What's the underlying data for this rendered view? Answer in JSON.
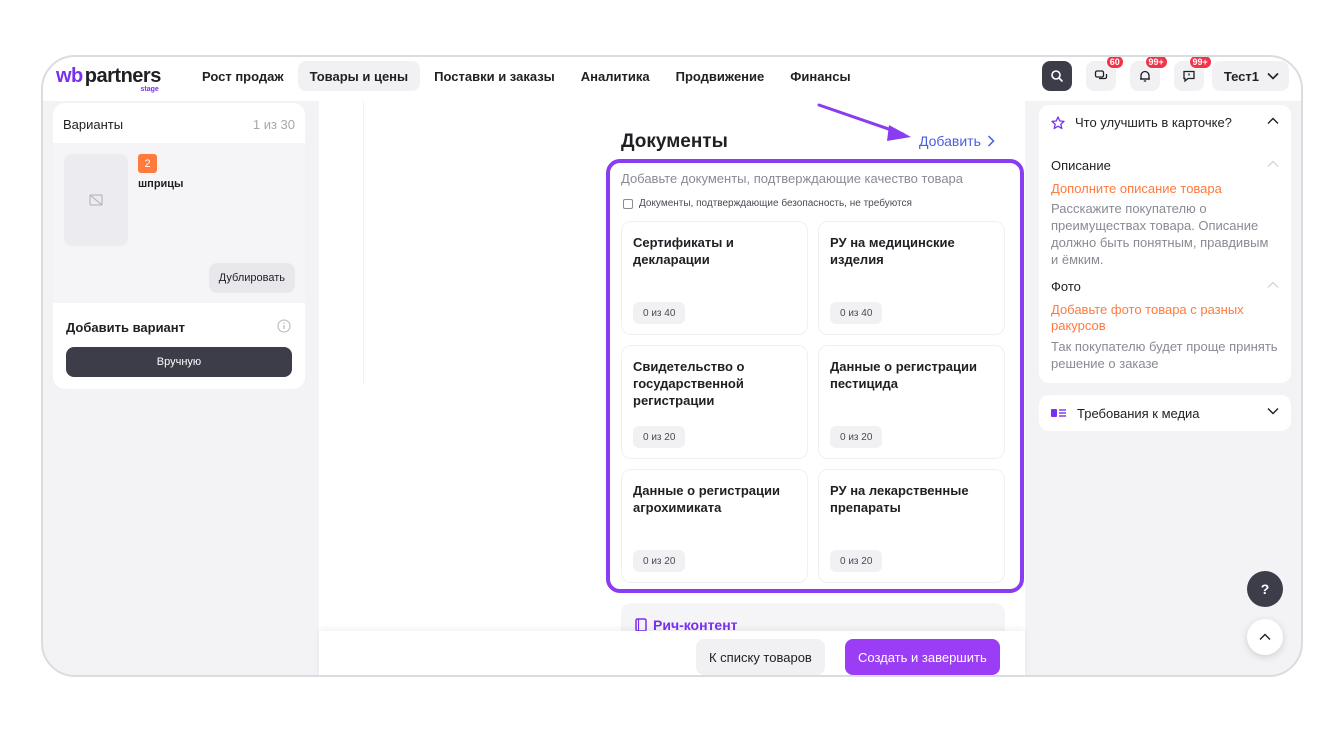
{
  "brand": {
    "wb": "wb",
    "partners": "partners",
    "env": "stage"
  },
  "nav": [
    "Рост продаж",
    "Товары и цены",
    "Поставки и заказы",
    "Аналитика",
    "Продвижение",
    "Финансы"
  ],
  "header": {
    "badges": {
      "chat": "60",
      "notifications": "99+",
      "support": "99+"
    },
    "user": "Тест1"
  },
  "variants": {
    "title": "Варианты",
    "count": "1 из 30",
    "item_number": "2",
    "item_name": "шприцы",
    "duplicate_label": "Дублировать",
    "add_variant_label": "Добавить вариант",
    "manual_label": "Вручную"
  },
  "documents": {
    "title": "Документы",
    "add_label": "Добавить",
    "subtitle": "Добавьте документы, подтверждающие качество товара",
    "checkbox_label": "Документы, подтверждающие безопасность, не требуются",
    "cards": [
      {
        "title": "Сертификаты и декларации",
        "count": "0 из 40"
      },
      {
        "title": "РУ на медицинские изделия",
        "count": "0 из 40"
      },
      {
        "title": "Свидетельство о государственной регистрации",
        "count": "0 из 20"
      },
      {
        "title": "Данные о регистрации пестицида",
        "count": "0 из 20"
      },
      {
        "title": "Данные о регистрации агрохимиката",
        "count": "0 из 20"
      },
      {
        "title": "РУ на лекарственные препараты",
        "count": "0 из 20"
      }
    ]
  },
  "rich_content": {
    "title": "Рич-контент"
  },
  "footer": {
    "back_label": "К списку товаров",
    "finish_label": "Создать и завершить"
  },
  "improve": {
    "title": "Что улучшить в карточке?",
    "sections": [
      {
        "head": "Описание",
        "link": "Дополните описание товара",
        "text": "Расскажите покупателю о преимуществах товара. Описание должно быть понятным, правдивым и ёмким."
      },
      {
        "head": "Фото",
        "link": "Добавьте фото товара с разных ракурсов",
        "text": "Так покупателю будет проще принять решение о заказе"
      }
    ]
  },
  "media": {
    "title": "Требования к медиа"
  },
  "help": {
    "label": "?"
  },
  "colors": {
    "accent": "#8a3cf0",
    "button_primary": "#9b3df5",
    "link_orange": "#ff7a3d",
    "badge_red": "#f0344a"
  }
}
